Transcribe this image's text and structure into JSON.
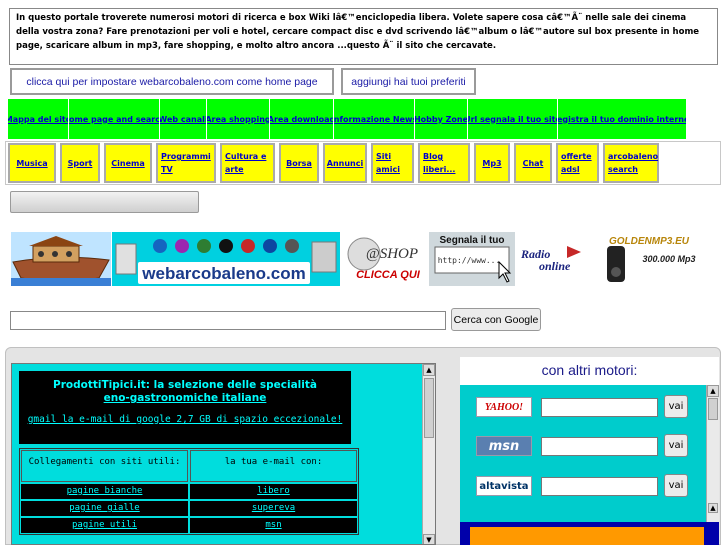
{
  "intro": {
    "text": "In questo portale troverete numerosi motori di ricerca e box Wiki lâ€™enciclopedia libera. Volete sapere cosa câ€™Ã¨ nelle sale dei cinema della vostra zona? Fare prenotazioni per voli e hotel, cercare compact disc e dvd scrivendo lâ€™album o lâ€™autore sul box presente in home page, scaricare album in mp3, fare shopping, e molto altro ancora ...questo Ã¨ il sito che cercavate."
  },
  "top_buttons": {
    "home": "clicca qui per impostare webarcobaleno.com come home page",
    "favorites": "aggiungi hai tuoi preferiti"
  },
  "nav": [
    "Mappa del sito",
    "Home page and search",
    "Web canali",
    "Area shopping",
    "Area download",
    "Informazione News",
    "Hobby Zone",
    "Url segnala il tuo sito",
    "Registra il tuo dominio internet"
  ],
  "categories": [
    "Musica",
    "Sport",
    "Cinema",
    "Programmi TV",
    "Cultura e arte",
    "Borsa",
    "Annunci",
    "Siti amici",
    "Blog liberi...",
    "Mp3",
    "Chat",
    "offerte adsl",
    "arcobaleno search"
  ],
  "banners": {
    "webarcobaleno": "webarcobaleno.com",
    "shop": "@SHOP",
    "shop_sub": "CLICCA QUI",
    "segnala": "Segnala il tuo",
    "segnala_url": "http://www...",
    "radio": "Radio",
    "radio_sub": "online",
    "mp3": "GOLDENMP3.EU",
    "mp3_sub": "300.000 Mp3"
  },
  "google": {
    "button": "Cerca con Google",
    "value": ""
  },
  "promo": {
    "title1": "ProdottiTipici.it: la selezione delle specialità",
    "title2": "eno-gastronomiche italiane",
    "link": "gmail la e-mail di google 2,7 GB di spazio eccezionale!"
  },
  "links_table": {
    "headers": [
      "Collegamenti con siti utili:",
      "la tua e-mail con:"
    ],
    "rows": [
      [
        "pagine bianche",
        "libero"
      ],
      [
        "pagine gialle",
        "supereva"
      ],
      [
        "pagine utili",
        "msn"
      ]
    ]
  },
  "other_engines": {
    "title": "con altri motori:",
    "engines": [
      {
        "name": "YAHOO!",
        "button": "vai",
        "color": "#cc0000"
      },
      {
        "name": "msn",
        "button": "vai",
        "color": "#336699"
      },
      {
        "name": "altavista",
        "button": "vai",
        "color": "#003366"
      }
    ]
  }
}
